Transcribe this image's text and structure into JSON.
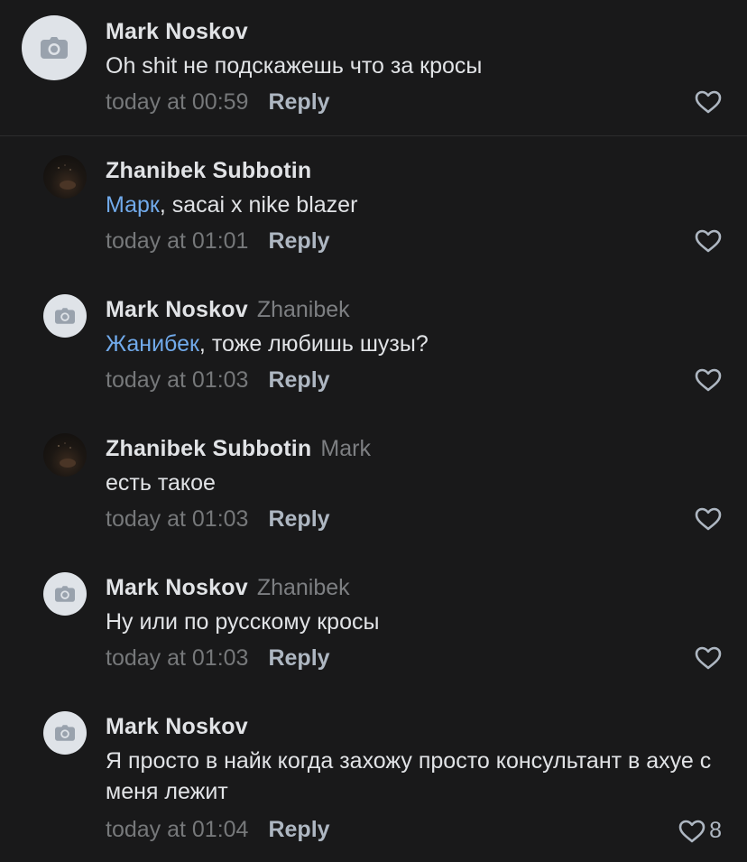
{
  "comments": [
    {
      "author": "Mark Noskov",
      "reply_to": "",
      "mention": "",
      "text": "Oh shit не подскажешь что за кросы",
      "time": "today at 00:59",
      "reply_label": "Reply",
      "likes": ""
    },
    {
      "author": "Zhanibek Subbotin",
      "reply_to": "",
      "mention": "Марк",
      "text": ", sacai x nike blazer",
      "time": "today at 01:01",
      "reply_label": "Reply",
      "likes": ""
    },
    {
      "author": "Mark Noskov",
      "reply_to": "Zhanibek",
      "mention": "Жанибек",
      "text": ", тоже любишь шузы?",
      "time": "today at 01:03",
      "reply_label": "Reply",
      "likes": ""
    },
    {
      "author": "Zhanibek Subbotin",
      "reply_to": "Mark",
      "mention": "",
      "text": "есть такое",
      "time": "today at 01:03",
      "reply_label": "Reply",
      "likes": ""
    },
    {
      "author": "Mark Noskov",
      "reply_to": "Zhanibek",
      "mention": "",
      "text": "Ну или по русскому кросы",
      "time": "today at 01:03",
      "reply_label": "Reply",
      "likes": ""
    },
    {
      "author": "Mark Noskov",
      "reply_to": "",
      "mention": "",
      "text": "Я просто в найк когда захожу просто консультант в ахуе с меня лежит",
      "time": "today at 01:04",
      "reply_label": "Reply",
      "likes": "8"
    }
  ],
  "icons": {
    "avatar_placeholder": "camera-icon",
    "like": "heart-icon"
  },
  "colors": {
    "background": "#19191a",
    "text": "#e1e3e6",
    "mention": "#71aaeb",
    "secondary": "#76787a",
    "reply": "#aeb7c2"
  }
}
